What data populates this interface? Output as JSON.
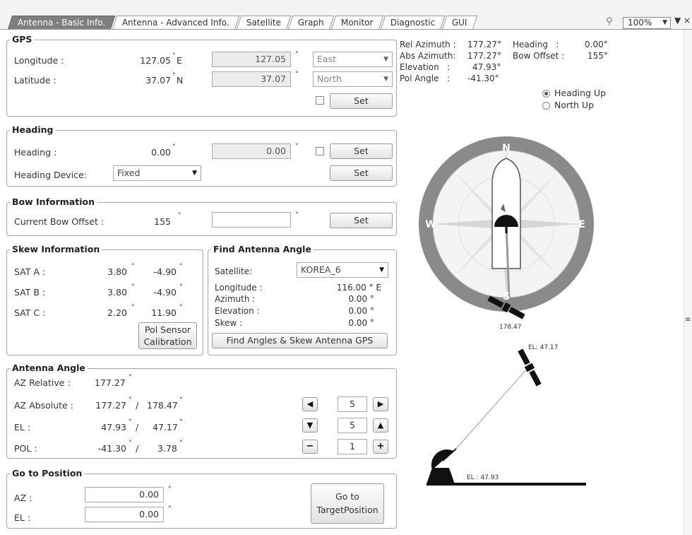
{
  "tabs": [
    "Antenna - Basic Info.",
    "Antenna - Advanced Info.",
    "Satellite",
    "Graph",
    "Monitor",
    "Diagnostic",
    "GUI"
  ],
  "zoom": "100%",
  "gps": {
    "title": "GPS",
    "lon_label": "Longitude :",
    "lon_value": "127.05",
    "lon_unit": "E",
    "lat_label": "Latitude :",
    "lat_value": "37.07",
    "lat_unit": "N",
    "lon_input": "127.05",
    "lat_input": "37.07",
    "lon_dir": "East",
    "lat_dir": "North",
    "set": "Set"
  },
  "heading": {
    "title": "Heading",
    "label": "Heading :",
    "value": "0.00",
    "input": "0.00",
    "set": "Set",
    "device_label": "Heading Device:",
    "device": "Fixed",
    "device_set": "Set"
  },
  "bow": {
    "title": "Bow Information",
    "label": "Current Bow Offset :",
    "value": "155",
    "set": "Set"
  },
  "skew": {
    "title": "Skew Information",
    "rows": [
      {
        "label": "SAT A :",
        "a": "3.80",
        "b": "-4.90"
      },
      {
        "label": "SAT B :",
        "a": "3.80",
        "b": "-4.90"
      },
      {
        "label": "SAT C :",
        "a": "2.20",
        "b": "11.90"
      }
    ],
    "pol_btn_1": "Pol Sensor",
    "pol_btn_2": "Calibration"
  },
  "find": {
    "title": "Find Antenna Angle",
    "sat_label": "Satellite:",
    "sat": "KOREA_6",
    "lon_label": "Longitude :",
    "lon": "116.00 ° E",
    "az_label": "Azimuth :",
    "az": "0.00 °",
    "el_label": "Elevation :",
    "el": "0.00 °",
    "skew_label": "Skew :",
    "skew": "0.00 °",
    "btn": "Find Angles & Skew Antenna GPS"
  },
  "angle": {
    "title": "Antenna Angle",
    "az_rel_label": "AZ Relative :",
    "az_rel": "177.27",
    "az_abs_label": "AZ Absolute :",
    "az_abs": "177.27",
    "az_abs2": "178.47",
    "el_label": "EL :",
    "el": "47.93",
    "el2": "47.17",
    "pol_label": "POL :",
    "pol": "-41.30",
    "pol2": "3.78",
    "step_az": "5",
    "step_el": "5",
    "step_pol": "1"
  },
  "goto": {
    "title": "Go to Position",
    "az_label": "AZ :",
    "az": "0.00",
    "el_label": "EL :",
    "el": "0.00",
    "btn_1": "Go to",
    "btn_2": "TargetPosition"
  },
  "status": {
    "rel_az_label": "Rel Azimuth :",
    "rel_az": "177.27°",
    "abs_az_label": "Abs Azimuth:",
    "abs_az": "177.27°",
    "elev_label": "Elevation   :",
    "elev": "47.93°",
    "pol_label": "Pol Angle   :",
    "pol": "-41.30°",
    "heading_label": "Heading   :",
    "heading": "0.00°",
    "bow_label": "Bow Offset :",
    "bow": "155°"
  },
  "view": {
    "heading_up": "Heading Up",
    "north_up": "North Up"
  },
  "compass": {
    "n": "N",
    "s": "S",
    "e": "E",
    "w": "W",
    "sat_az": "178.47"
  },
  "elev_view": {
    "sat_el": "EL: 47.17",
    "ant_el": "EL : 47.93"
  }
}
